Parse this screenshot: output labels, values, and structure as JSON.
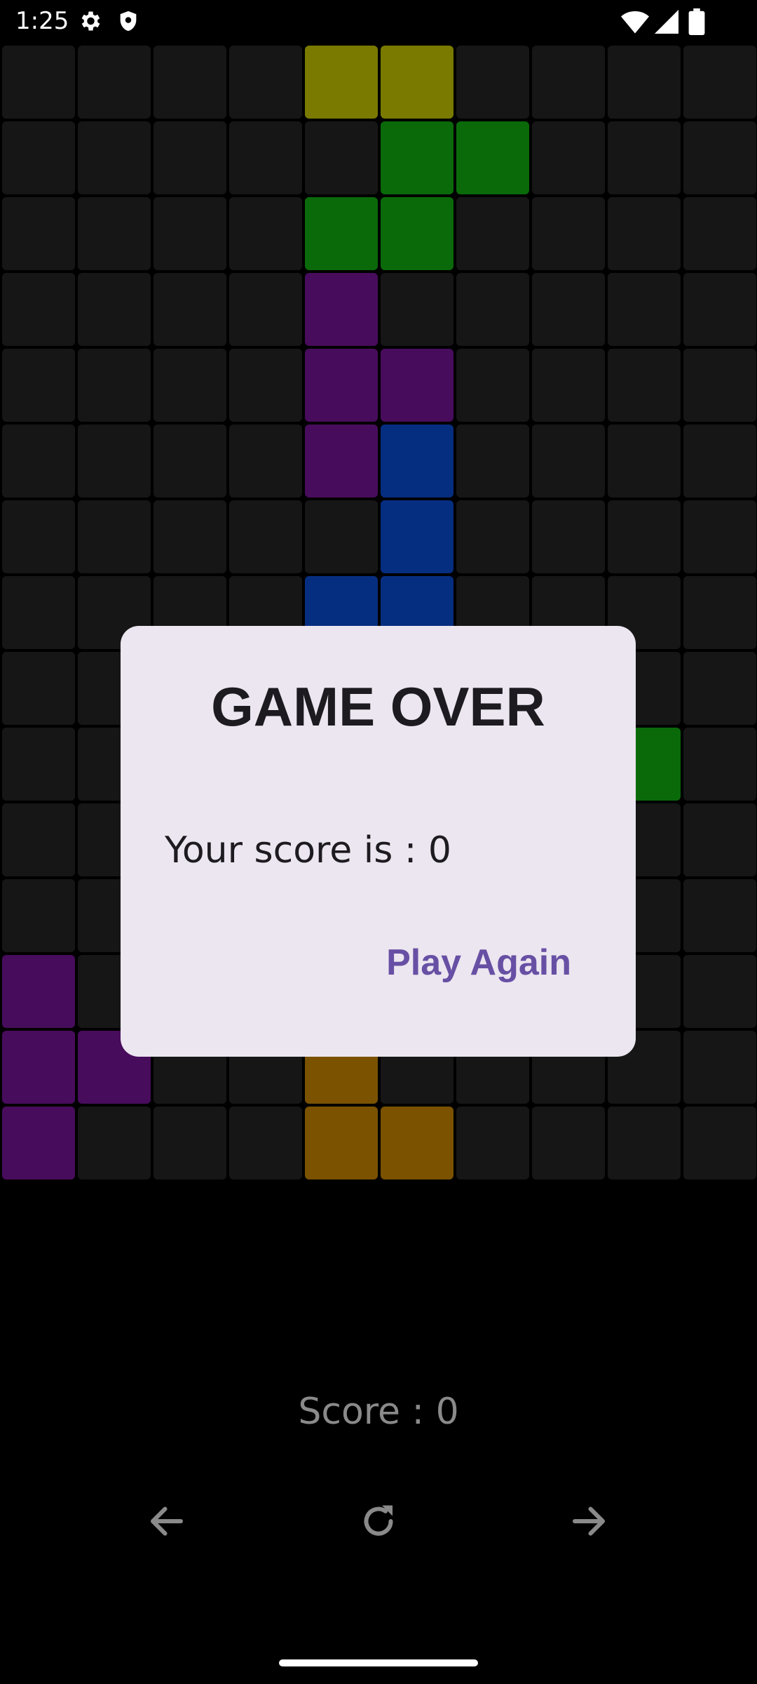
{
  "status_bar": {
    "time": "1:25",
    "icons": [
      "gear-icon",
      "shield-icon",
      "wifi-icon",
      "signal-icon",
      "battery-icon"
    ]
  },
  "board": {
    "columns": 10,
    "rows": 15,
    "empty_color": "#161616",
    "colors": {
      "y": "#7a7a00",
      "g": "#0a6a0a",
      "p": "#480c5c",
      "b": "#062e80",
      "o": "#7a5200"
    },
    "grid": [
      "....yy....",
      ".....gg...",
      "....gg....",
      "....p.....",
      "....pp....",
      "....pb....",
      ".....b....",
      "....bb....",
      "..........",
      "........g.",
      "..........",
      "..........",
      "p.........",
      "pp..o.....",
      "p...oo...."
    ]
  },
  "dialog": {
    "title": "GAME OVER",
    "message": "Your score is : 0",
    "button": "Play Again"
  },
  "score": {
    "label": "Score : 0"
  },
  "controls": {
    "icons": [
      "arrow-left-icon",
      "rotate-icon",
      "arrow-right-icon"
    ]
  }
}
